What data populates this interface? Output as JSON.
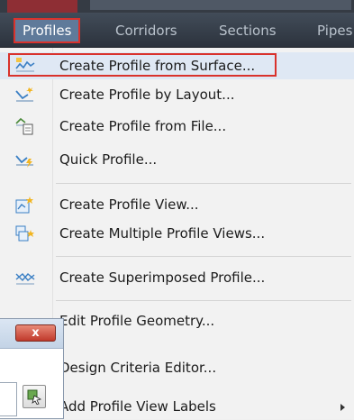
{
  "menubar": {
    "tabs": [
      {
        "label": "Profiles",
        "active": true
      },
      {
        "label": "Corridors",
        "active": false
      },
      {
        "label": "Sections",
        "active": false
      },
      {
        "label": "Pipes",
        "active": false
      }
    ]
  },
  "menu": {
    "items": [
      {
        "label": "Create Profile from Surface...",
        "icon": "profile-surface-icon",
        "highlighted": true
      },
      {
        "label": "Create Profile by Layout...",
        "icon": "profile-layout-icon"
      },
      {
        "label": "Create Profile from File...",
        "icon": "profile-file-icon"
      },
      {
        "label": "Quick Profile...",
        "icon": "quick-profile-icon"
      },
      {
        "label": "Create Profile View...",
        "icon": "profile-view-icon"
      },
      {
        "label": "Create Multiple Profile Views...",
        "icon": "multiple-profile-views-icon"
      },
      {
        "label": "Create Superimposed Profile...",
        "icon": "superimposed-profile-icon"
      },
      {
        "label": "Edit Profile Geometry...",
        "icon": "edit-geometry-icon"
      },
      {
        "label": "Design Criteria Editor...",
        "icon": "design-criteria-icon"
      },
      {
        "label": "Add Profile View Labels",
        "icon": "add-labels-icon",
        "submenu": true
      }
    ]
  },
  "dialog": {
    "close_label": "x"
  },
  "colors": {
    "highlight_border": "#d9322c",
    "menubar_bg": "#2c333d",
    "menu_bg": "#f2f2f2"
  }
}
